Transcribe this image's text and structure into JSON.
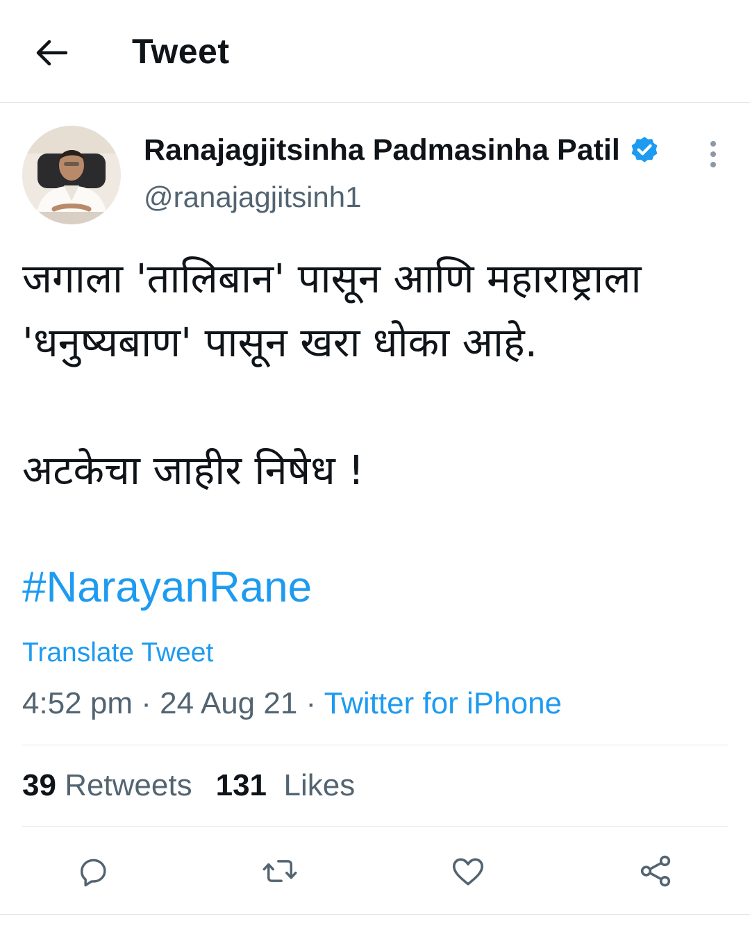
{
  "header": {
    "title": "Tweet",
    "back_icon": "arrow-left-icon"
  },
  "author": {
    "display_name": "Ranajagjitsinha Padmasinha Patil",
    "handle": "@ranajagjitsinh1",
    "verified_icon": "verified-badge-icon",
    "more_icon": "more-vertical-icon"
  },
  "tweet": {
    "lines": [
      "जगाला 'तालिबान' पासून आणि महाराष्ट्राला",
      "'धनुष्यबाण' पासून खरा धोका आहे.",
      "अटकेचा जाहीर निषेध !"
    ],
    "hashtag": "#NarayanRane",
    "translate_label": "Translate Tweet",
    "time": "4:52 pm",
    "date": "24 Aug 21",
    "separator": "·",
    "source": "Twitter for iPhone"
  },
  "stats": {
    "retweets_count": "39",
    "retweets_label": "Retweets",
    "likes_count": "131",
    "likes_label": "Likes"
  },
  "actions": [
    {
      "name": "reply",
      "icon": "reply-icon"
    },
    {
      "name": "retweet",
      "icon": "retweet-icon"
    },
    {
      "name": "like",
      "icon": "heart-icon"
    },
    {
      "name": "share",
      "icon": "share-icon"
    }
  ],
  "colors": {
    "accent": "#1d9bf0",
    "text_primary": "#0f1419",
    "text_secondary": "#536471",
    "divider": "#e4e7ea"
  }
}
